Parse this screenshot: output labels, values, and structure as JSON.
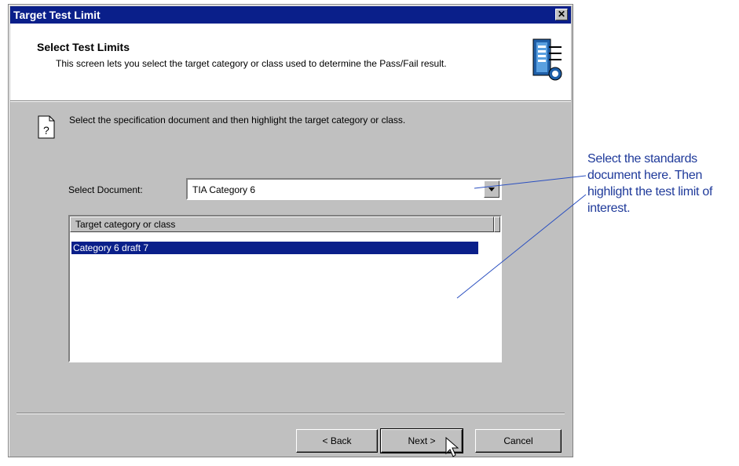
{
  "window": {
    "title": "Target Test Limit"
  },
  "header": {
    "title": "Select Test Limits",
    "description": "This screen lets you select the target category or class used to determine the Pass/Fail result.",
    "icon": "test-limits-document-icon"
  },
  "body": {
    "hint_icon": "help-document-icon",
    "instructions": "Select the specification document and then highlight the target category or class.",
    "document_label": "Select Document:",
    "document_value": "TIA Category 6",
    "list": {
      "column_header": "Target category or class",
      "items": [
        "Category 6 draft 7"
      ],
      "selected_index": 0
    }
  },
  "footer": {
    "back_label": "< Back",
    "next_label": "Next >",
    "cancel_label": "Cancel"
  },
  "annotation": {
    "text": "Select the standards document here.  Then highlight the test limit of interest.",
    "color": "#1f3a9a"
  },
  "colors": {
    "titlebar": "#0a1f8a",
    "selection": "#0a1f8a",
    "dialog_face": "#c0c0c0"
  }
}
